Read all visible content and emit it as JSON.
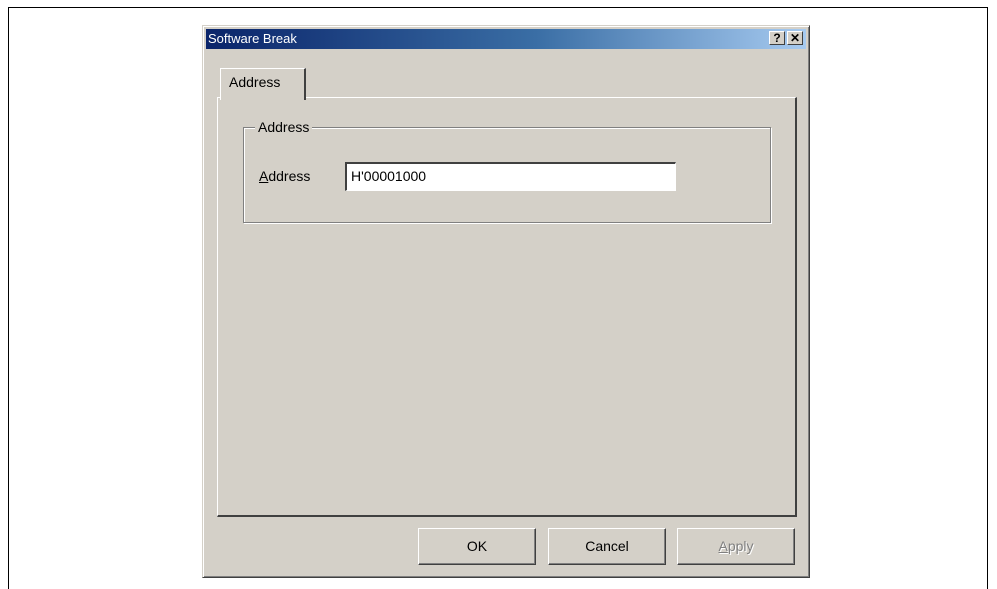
{
  "window": {
    "title": "Software Break",
    "help_glyph": "?",
    "close_glyph": "✕"
  },
  "tabs": [
    {
      "label": "Address",
      "selected": true
    }
  ],
  "group": {
    "legend": "Address",
    "field_label_mnemonic": "A",
    "field_label_rest": "ddress",
    "field_value": "H'00001000"
  },
  "buttons": {
    "ok": "OK",
    "cancel": "Cancel",
    "apply_mnemonic": "A",
    "apply_rest": "pply",
    "apply_enabled": false
  },
  "colors": {
    "dialog_face": "#d4d0c8",
    "titlebar_start": "#0a246a",
    "titlebar_end": "#a6caf0",
    "disabled_text": "#808080"
  }
}
